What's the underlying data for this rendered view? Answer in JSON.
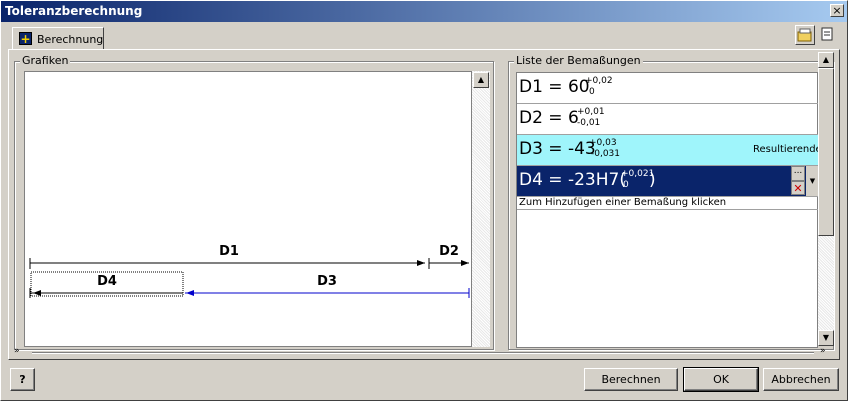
{
  "window": {
    "title": "Toleranzberechnung",
    "close_glyph": "×"
  },
  "tabs": [
    {
      "label": "Berechnung",
      "icon": "plus-icon"
    }
  ],
  "graphics": {
    "group_label": "Grafiken",
    "dimensions": [
      {
        "label": "D1"
      },
      {
        "label": "D2"
      },
      {
        "label": "D4"
      },
      {
        "label": "D3"
      }
    ]
  },
  "dimension_list": {
    "group_label": "Liste der Bemaßungen",
    "rows": [
      {
        "main": "D1 = 60",
        "tol_upper": "+0,02",
        "tol_lower": "0",
        "note": ""
      },
      {
        "main": "D2 = 6",
        "tol_upper": "+0,01",
        "tol_lower": "-0,01",
        "note": ""
      },
      {
        "main": "D3 = -43",
        "tol_upper": "+0,03",
        "tol_lower": "-0,031",
        "note": "Resultierende"
      },
      {
        "main": "D4 = -23H7(",
        "tol_upper": "+0,021",
        "tol_lower": "0",
        "close": ")",
        "note": ""
      }
    ],
    "add_hint": "Zum Hinzufügen einer Bemaßung klicken",
    "row_button_dots": "...",
    "row_button_delete": "✕"
  },
  "buttons": {
    "help": "?",
    "calculate": "Berechnen",
    "ok": "OK",
    "cancel": "Abbrechen"
  },
  "colors": {
    "titlebar_start": "#0a246a",
    "titlebar_end": "#a6caf0",
    "result_row": "#9ff5fb",
    "selected_row": "#0a246a",
    "dimension_line": "#000000",
    "result_line": "#0000cc"
  }
}
